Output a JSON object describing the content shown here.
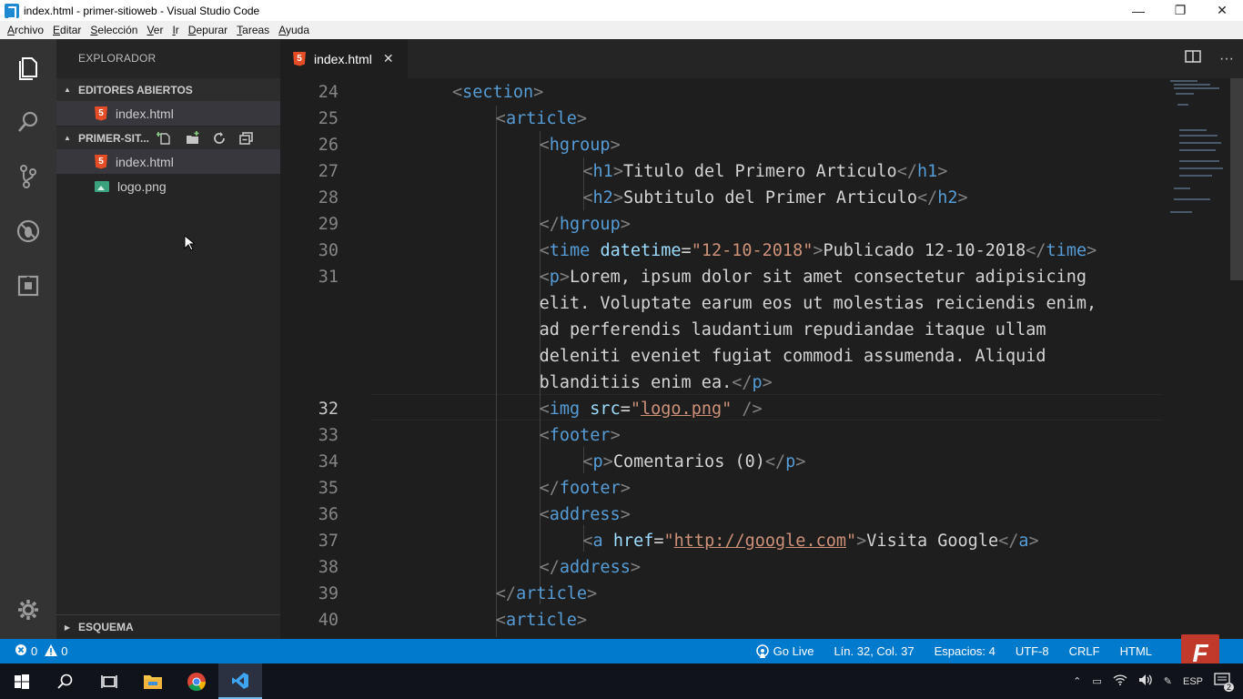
{
  "window": {
    "title": "index.html - primer-sitioweb - Visual Studio Code",
    "minimize": "—",
    "maximize": "❐",
    "close": "✕"
  },
  "menu": [
    "Archivo",
    "Editar",
    "Selección",
    "Ver",
    "Ir",
    "Depurar",
    "Tareas",
    "Ayuda"
  ],
  "sidebar": {
    "title": "EXPLORADOR",
    "open_editors_label": "EDITORES ABIERTOS",
    "open_editors": [
      {
        "label": "index.html",
        "icon": "html5-icon"
      }
    ],
    "project_label": "PRIMER-SIT...",
    "files": [
      {
        "label": "index.html",
        "icon": "html5-icon"
      },
      {
        "label": "logo.png",
        "icon": "image-icon"
      }
    ],
    "outline_label": "ESQUEMA"
  },
  "tab": {
    "label": "index.html",
    "close": "✕",
    "more": "···"
  },
  "editor": {
    "current_line": 32,
    "lines": [
      {
        "n": "24",
        "code": "<section>"
      },
      {
        "n": "25",
        "code": "    <article>"
      },
      {
        "n": "26",
        "code": "        <hgroup>"
      },
      {
        "n": "27",
        "code": "            <h1>Titulo del Primero Articulo</h1>"
      },
      {
        "n": "28",
        "code": "            <h2>Subtitulo del Primer Articulo</h2>"
      },
      {
        "n": "29",
        "code": "        </hgroup>"
      },
      {
        "n": "30",
        "code": "        <time datetime=\"12-10-2018\">Publicado 12-10-2018</time>"
      },
      {
        "n": "31",
        "code": "        <p>Lorem, ipsum dolor sit amet consectetur adipisicing"
      },
      {
        "n": "",
        "code": "        elit. Voluptate earum eos ut molestias reiciendis enim,"
      },
      {
        "n": "",
        "code": "        ad perferendis laudantium repudiandae itaque ullam"
      },
      {
        "n": "",
        "code": "        deleniti eveniet fugiat commodi assumenda. Aliquid"
      },
      {
        "n": "",
        "code": "        blanditiis enim ea.</p>"
      },
      {
        "n": "32",
        "code": "        <img src=\"logo.png\" />"
      },
      {
        "n": "33",
        "code": "        <footer>"
      },
      {
        "n": "34",
        "code": "            <p>Comentarios (0)</p>"
      },
      {
        "n": "35",
        "code": "        </footer>"
      },
      {
        "n": "36",
        "code": "        <address>"
      },
      {
        "n": "37",
        "code": "            <a href=\"http://google.com\">Visita Google</a>"
      },
      {
        "n": "38",
        "code": "        </address>"
      },
      {
        "n": "39",
        "code": "    </article>"
      },
      {
        "n": "40",
        "code": "    <article>"
      }
    ]
  },
  "status": {
    "errors": "0",
    "warnings": "0",
    "go_live": "Go Live",
    "position": "Lín. 32, Col. 37",
    "spaces": "Espacios: 4",
    "encoding": "UTF-8",
    "eol": "CRLF",
    "language": "HTML"
  },
  "taskbar": {
    "lang": "ESP",
    "notifications": "2"
  },
  "colors": {
    "accent": "#007acc",
    "tag": "#569cd6",
    "attr": "#9cdcfe",
    "string": "#ce9178"
  }
}
